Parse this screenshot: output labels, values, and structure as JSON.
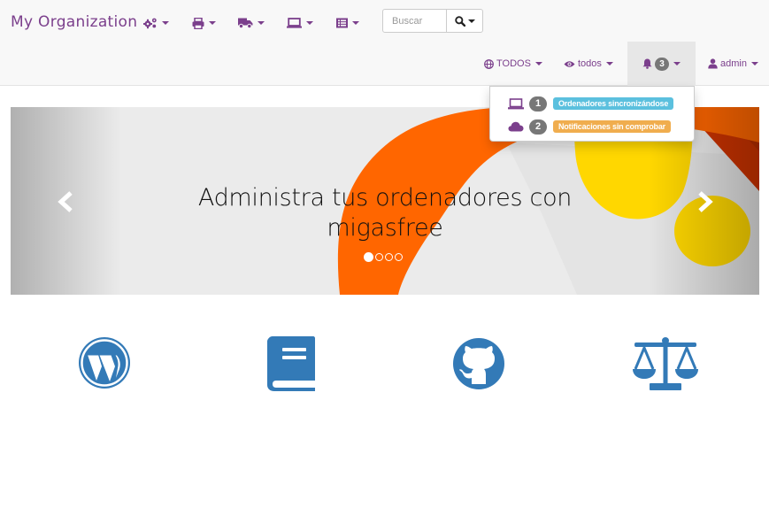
{
  "brand": "My Organization",
  "top_menu": [
    {
      "icon": "cogs-icon"
    },
    {
      "icon": "print-icon"
    },
    {
      "icon": "truck-icon"
    },
    {
      "icon": "laptop-icon"
    },
    {
      "icon": "list-icon"
    }
  ],
  "search": {
    "placeholder": "Buscar",
    "icon": "search-icon"
  },
  "nav_right": {
    "projects": {
      "label": "TODOS",
      "icon": "globe-icon"
    },
    "view": {
      "label": "todos",
      "icon": "eye-icon"
    },
    "alerts": {
      "count": "3",
      "icon": "bell-icon"
    },
    "user": {
      "label": "admin",
      "icon": "user-icon"
    }
  },
  "alerts_dropdown": [
    {
      "icon": "laptop-icon",
      "count": "1",
      "label": "Ordenadores sincronizándose",
      "color": "#5bc0de"
    },
    {
      "icon": "cloud-icon",
      "count": "2",
      "label": "Notificaciones sin comprobar",
      "color": "#f0ad4e"
    }
  ],
  "carousel": {
    "caption_line1": "Administra tus ordenadores con",
    "caption_line2": "migasfree",
    "slide_count": 4,
    "active_index": 0
  },
  "links": [
    {
      "icon": "wordpress-icon"
    },
    {
      "icon": "book-icon"
    },
    {
      "icon": "github-icon"
    },
    {
      "icon": "balance-scale-icon"
    }
  ],
  "colors": {
    "brand": "#7b3f8c",
    "link_icons": "#337ab7",
    "carousel_orange": "#ff6600",
    "carousel_yellow": "#ffd700"
  }
}
